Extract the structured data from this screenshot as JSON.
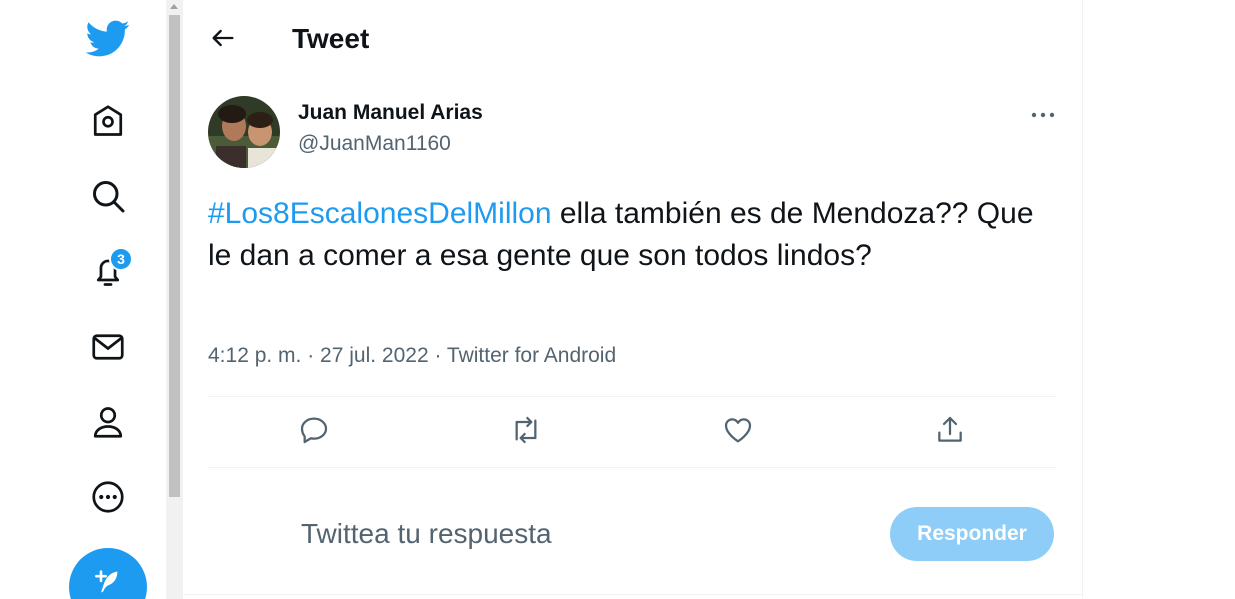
{
  "sidebar": {
    "notifications_badge": "3"
  },
  "header": {
    "title": "Tweet"
  },
  "tweet": {
    "author_name": "Juan Manuel Arias",
    "author_handle": "@JuanMan1160",
    "hashtag": "#Los8EscalonesDelMillon",
    "text": " ella también es de Mendoza?? Que le dan a comer a esa gente que son todos lindos?",
    "meta": "4:12 p. m. · 27 jul. 2022 · Twitter for Android"
  },
  "reply": {
    "placeholder": "Twittea tu respuesta",
    "button_label": "Responder"
  },
  "colors": {
    "brand": "#1d9bf0",
    "reply_button_disabled": "#8ecdf8",
    "secondary_text": "#536471"
  },
  "icons": {
    "logo": "twitter-bird-icon",
    "nav": [
      "home-icon",
      "search-icon",
      "bell-icon",
      "mail-icon",
      "profile-icon",
      "more-circle-icon"
    ],
    "actions": [
      "reply-icon",
      "retweet-icon",
      "like-icon",
      "share-icon"
    ],
    "compose": "compose-feather-icon"
  }
}
